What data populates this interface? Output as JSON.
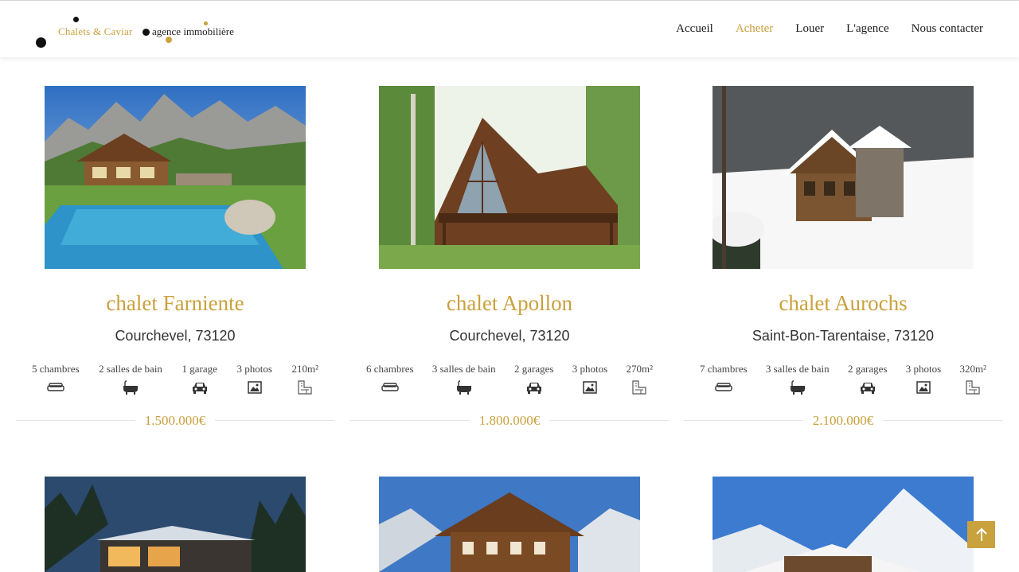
{
  "logo": {
    "brand": "Chalets & Caviar",
    "tagline": "agence immobilière"
  },
  "nav": [
    {
      "label": "Accueil"
    },
    {
      "label": "Acheter",
      "active": true
    },
    {
      "label": "Louer"
    },
    {
      "label": "L'agence"
    },
    {
      "label": "Nous contacter"
    }
  ],
  "listings": [
    {
      "title": "chalet Farniente",
      "location": "Courchevel, 73120",
      "features": [
        "5 chambres",
        "2 salles de bain",
        "1 garage",
        "3 photos",
        "210m²"
      ],
      "price": "1.500.000€"
    },
    {
      "title": "chalet Apollon",
      "location": "Courchevel, 73120",
      "features": [
        "6 chambres",
        "3 salles de bain",
        "2 garages",
        "3 photos",
        "270m²"
      ],
      "price": "1.800.000€"
    },
    {
      "title": "chalet Aurochs",
      "location": "Saint-Bon-Tarentaise, 73120",
      "features": [
        "7 chambres",
        "3 salles de bain",
        "2 garages",
        "3 photos",
        "320m²"
      ],
      "price": "2.100.000€"
    }
  ],
  "feature_icons": [
    "bed-icon",
    "bathtub-icon",
    "car-icon",
    "image-icon",
    "floorplan-icon"
  ],
  "colors": {
    "accent": "#c9a13d",
    "text": "#222222"
  }
}
